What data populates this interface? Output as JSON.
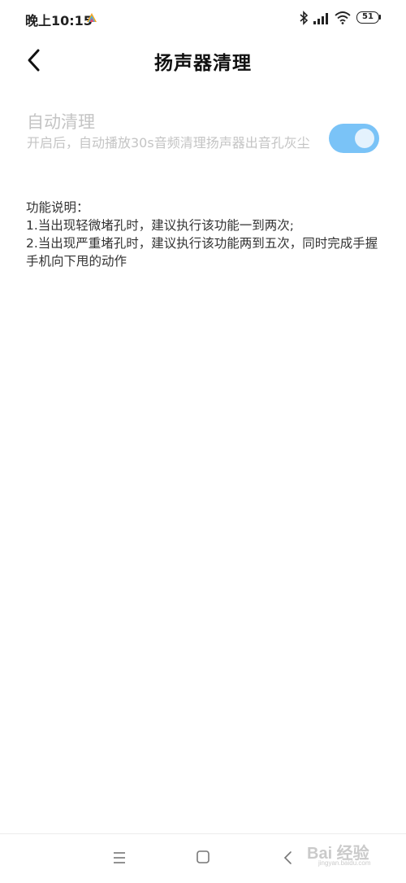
{
  "status_bar": {
    "time": "晚上10:15",
    "battery": "51"
  },
  "header": {
    "title": "扬声器清理"
  },
  "setting": {
    "title": "自动清理",
    "description": "开启后，自动播放30s音频清理扬声器出音孔灰尘",
    "toggle_on": true,
    "toggle_color": "#7ac3f7"
  },
  "info": {
    "heading": "功能说明：",
    "lines": [
      "1.当出现轻微堵孔时，建议执行该功能一到两次;",
      "2.当出现严重堵孔时，建议执行该功能两到五次，同时完成手握手机向下甩的动作"
    ]
  },
  "watermark": {
    "text": "Bai 经验",
    "sub": "jingyan.baidu.com"
  },
  "icons": {
    "back": "chevron-left-icon",
    "menu": "menu-icon",
    "home": "square-home-icon",
    "nav_back": "chevron-left-icon"
  }
}
